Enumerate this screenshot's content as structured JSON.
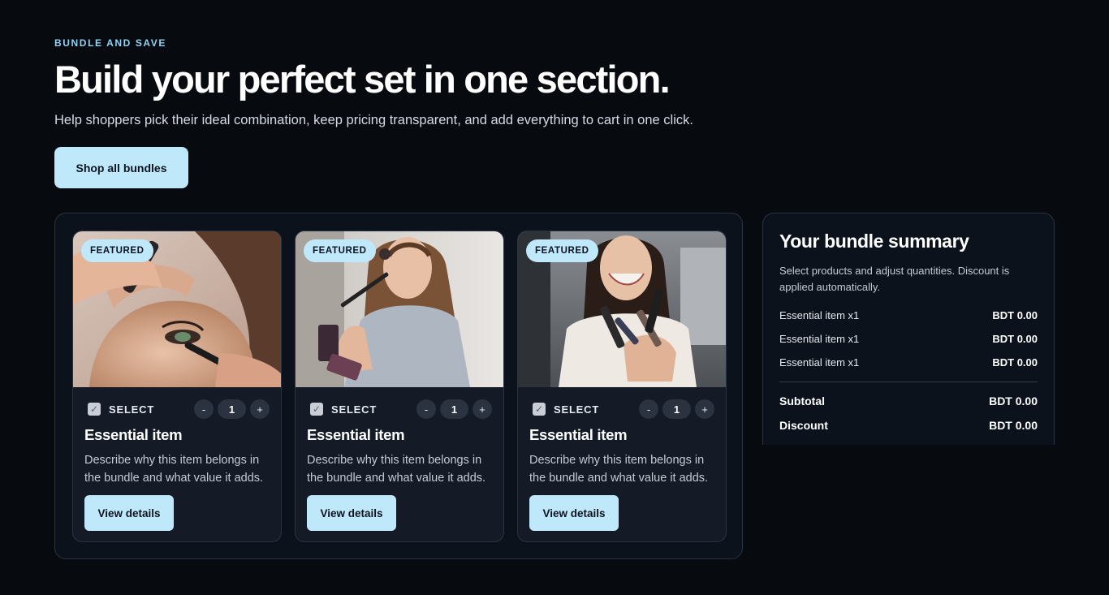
{
  "hero": {
    "eyebrow": "BUNDLE AND SAVE",
    "headline": "Build your perfect set in one section.",
    "subline": "Help shoppers pick their ideal combination, keep pricing transparent, and add everything to cart in one click.",
    "cta_label": "Shop all bundles"
  },
  "products": [
    {
      "badge": "FEATURED",
      "select_label": "SELECT",
      "selected": true,
      "qty_minus": "-",
      "quantity": "1",
      "qty_plus": "+",
      "title": "Essential item",
      "description": "Describe why this item belongs in the bundle and what value it adds.",
      "button_label": "View details"
    },
    {
      "badge": "FEATURED",
      "select_label": "SELECT",
      "selected": true,
      "qty_minus": "-",
      "quantity": "1",
      "qty_plus": "+",
      "title": "Essential item",
      "description": "Describe why this item belongs in the bundle and what value it adds.",
      "button_label": "View details"
    },
    {
      "badge": "FEATURED",
      "select_label": "SELECT",
      "selected": true,
      "qty_minus": "-",
      "quantity": "1",
      "qty_plus": "+",
      "title": "Essential item",
      "description": "Describe why this item belongs in the bundle and what value it adds.",
      "button_label": "View details"
    }
  ],
  "summary": {
    "title": "Your bundle summary",
    "description": "Select products and adjust quantities. Discount is applied automatically.",
    "items": [
      {
        "name": "Essential item x1",
        "price": "BDT 0.00"
      },
      {
        "name": "Essential item x1",
        "price": "BDT 0.00"
      },
      {
        "name": "Essential item x1",
        "price": "BDT 0.00"
      }
    ],
    "subtotal_label": "Subtotal",
    "subtotal_value": "BDT 0.00",
    "discount_label": "Discount",
    "discount_value": "BDT 0.00"
  },
  "colors": {
    "background": "#070a0f",
    "accent": "#bfe9fb",
    "eyebrow": "#8fd3f5",
    "panel": "#0c121b",
    "card": "#141b26"
  },
  "icons": {
    "checkbox": "checkmark-icon"
  }
}
